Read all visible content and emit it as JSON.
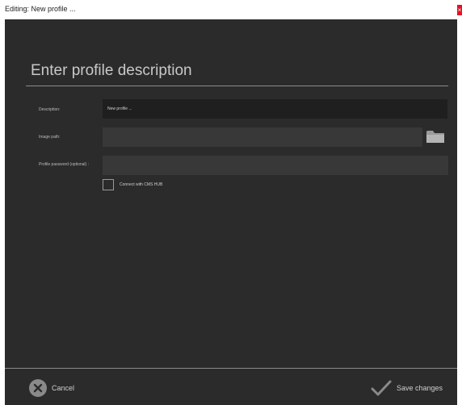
{
  "window": {
    "title": "Editing: New profile ...",
    "close_label": "×"
  },
  "form": {
    "heading": "Enter profile description",
    "description_label": "Description:",
    "description_value": "New profile ...",
    "image_path_label": "Image path:",
    "image_path_value": "",
    "password_label": "Profile password (optional) :",
    "password_value": "",
    "connect_label": "Connect with CMS HUB",
    "connect_checked": false
  },
  "footer": {
    "cancel_label": "Cancel",
    "save_label": "Save changes"
  },
  "icons": {
    "cancel": "x-circle-icon",
    "save": "checkmark-icon",
    "browse": "folder-icon"
  },
  "colors": {
    "background": "#2b2b2b",
    "field_dark": "#1f1f1f",
    "field_light": "#383838",
    "text": "#cfcfcf",
    "close_red": "#e81123"
  }
}
